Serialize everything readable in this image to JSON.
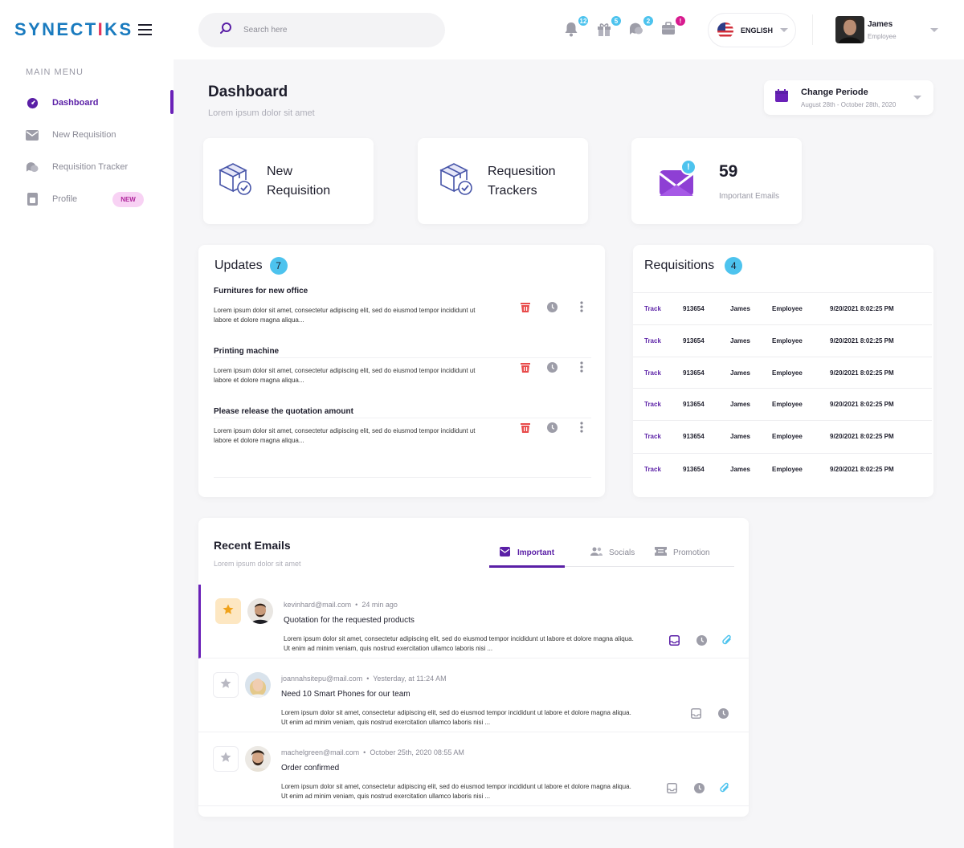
{
  "brand": {
    "logo_pre": "SYNECT",
    "logo_i": "I",
    "logo_post": "KS"
  },
  "sidebar": {
    "menu_title": "MAIN MENU",
    "items": [
      {
        "label": "Dashboard",
        "icon": "dashboard-icon"
      },
      {
        "label": "New Requisition",
        "icon": "mail-icon"
      },
      {
        "label": "Requisition Tracker",
        "icon": "chat-icon"
      },
      {
        "label": "Profile",
        "icon": "profile-icon",
        "badge": "NEW"
      }
    ]
  },
  "topbar": {
    "search_placeholder": "Search here",
    "notifications": [
      {
        "icon": "bell-icon",
        "count": "12"
      },
      {
        "icon": "gift-icon",
        "count": "5"
      },
      {
        "icon": "chat-icon",
        "count": "2"
      },
      {
        "icon": "briefcase-icon",
        "count": "!"
      }
    ],
    "language": "ENGLISH",
    "user_name": "James",
    "user_role": "Employee"
  },
  "header": {
    "title": "Dashboard",
    "subtitle": "Lorem ipsum  dolor sit amet",
    "period_title": "Change Periode",
    "period_range": "August 28th - October 28th, 2020"
  },
  "stats": {
    "new_req_l1": "New",
    "new_req_l2": "Requisition",
    "trackers_l1": "Requesition",
    "trackers_l2": "Trackers",
    "emails_count": "59",
    "emails_label": "Important Emails",
    "emails_badge": "!"
  },
  "updates": {
    "title": "Updates",
    "count": "7",
    "items": [
      {
        "title": "Furnitures for new office",
        "text": "Lorem ipsum dolor sit amet, consectetur adipiscing elit, sed do eiusmod tempor incididunt ut labore et dolore magna aliqua..."
      },
      {
        "title": "Printing machine",
        "text": "Lorem ipsum dolor sit amet, consectetur adipiscing elit, sed do eiusmod tempor incididunt ut labore et dolore magna aliqua..."
      },
      {
        "title": "Please release the quotation amount",
        "text": "Lorem ipsum dolor sit amet, consectetur adipiscing elit, sed do eiusmod tempor incididunt ut labore et dolore magna aliqua..."
      }
    ]
  },
  "requisitions": {
    "title": "Requisitions",
    "count": "4",
    "rows": [
      {
        "action": "Track",
        "id": "913654",
        "name": "James",
        "role": "Employee",
        "date": "9/20/2021 8:02:25 PM"
      },
      {
        "action": "Track",
        "id": "913654",
        "name": "James",
        "role": "Employee",
        "date": "9/20/2021 8:02:25 PM"
      },
      {
        "action": "Track",
        "id": "913654",
        "name": "James",
        "role": "Employee",
        "date": "9/20/2021 8:02:25 PM"
      },
      {
        "action": "Track",
        "id": "913654",
        "name": "James",
        "role": "Employee",
        "date": "9/20/2021 8:02:25 PM"
      },
      {
        "action": "Track",
        "id": "913654",
        "name": "James",
        "role": "Employee",
        "date": "9/20/2021 8:02:25 PM"
      },
      {
        "action": "Track",
        "id": "913654",
        "name": "James",
        "role": "Employee",
        "date": "9/20/2021 8:02:25 PM"
      }
    ]
  },
  "emails": {
    "title": "Recent Emails",
    "subtitle": "Lorem ipsum dolor sit amet",
    "tabs": [
      "Important",
      "Socials",
      "Promotion"
    ],
    "items": [
      {
        "from": "kevinhard@mail.com",
        "time": "24 min ago",
        "subject": "Quotation for the requested products",
        "body": "Lorem ipsum dolor sit amet, consectetur adipiscing elit, sed do eiusmod tempor incididunt ut labore et dolore magna aliqua. Ut enim ad minim veniam, quis nostrud exercitation ullamco laboris nisi ..."
      },
      {
        "from": "joannahsitepu@mail.com",
        "time": "Yesterday, at 11:24 AM",
        "subject": "Need 10 Smart Phones for our team",
        "body": "Lorem ipsum dolor sit amet, consectetur adipiscing elit, sed do eiusmod tempor incididunt ut labore et dolore magna aliqua. Ut enim ad minim veniam, quis nostrud exercitation ullamco laboris nisi ..."
      },
      {
        "from": "machelgreen@mail.com",
        "time": "October 25th, 2020  08:55 AM",
        "subject": "Order confirmed",
        "body": "Lorem ipsum dolor sit amet, consectetur adipiscing elit, sed do eiusmod tempor incididunt ut labore et dolore magna aliqua. Ut enim ad minim veniam, quis nostrud exercitation ullamco laboris nisi ..."
      }
    ]
  },
  "colors": {
    "accent": "#5a1fa6",
    "brand": "#1a7bbf",
    "badge": "#4dc3ee",
    "danger": "#e84b4b"
  }
}
